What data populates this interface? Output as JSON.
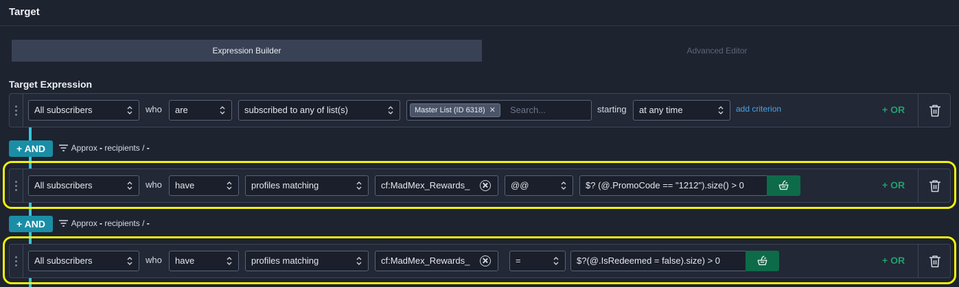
{
  "header": {
    "title": "Target"
  },
  "tabs": [
    {
      "label": "Expression Builder",
      "active": true
    },
    {
      "label": "Advanced Editor",
      "active": false
    }
  ],
  "section_title": "Target Expression",
  "criteria": [
    {
      "subject": "All subscribers",
      "who_label": "who",
      "verb": "are",
      "condition": "subscribed to any of list(s)",
      "list_chip": "Master List (ID 6318)",
      "search_placeholder": "Search...",
      "starting_label": "starting",
      "timing": "at any time",
      "add_criterion": "add criterion",
      "or_label": "+ OR"
    },
    {
      "subject": "All subscribers",
      "who_label": "who",
      "verb": "have",
      "condition": "profiles matching",
      "field": "cf:MadMex_Rewards_",
      "operator": "@@",
      "expression": "$? (@.PromoCode == \"1212\").size() > 0",
      "or_label": "+ OR",
      "highlighted": true
    },
    {
      "subject": "All subscribers",
      "who_label": "who",
      "verb": "have",
      "condition": "profiles matching",
      "field": "cf:MadMex_Rewards_",
      "operator": "=",
      "expression": "$?(@.IsRedeemed = false).size) > 0",
      "or_label": "+ OR",
      "highlighted": true
    }
  ],
  "and_groups": [
    {
      "and_label": "+ AND",
      "approx": "Approx",
      "dash1": "-",
      "recipients": "recipients /",
      "dash2": "-"
    },
    {
      "and_label": "+ AND",
      "approx": "Approx",
      "dash1": "-",
      "recipients": "recipients /",
      "dash2": "-"
    }
  ],
  "colors": {
    "background": "#1e2330",
    "and_button": "#1a8ea6",
    "rail": "#35c6dd",
    "or_text": "#21a06e",
    "wizard_button": "#0e6b49",
    "highlight": "#f2f20d",
    "link": "#4aa3e8"
  },
  "icons": [
    "chevron-updown-icon",
    "clear-icon",
    "wand-icon",
    "trash-icon",
    "filter-icon",
    "drag-handle-icon"
  ]
}
